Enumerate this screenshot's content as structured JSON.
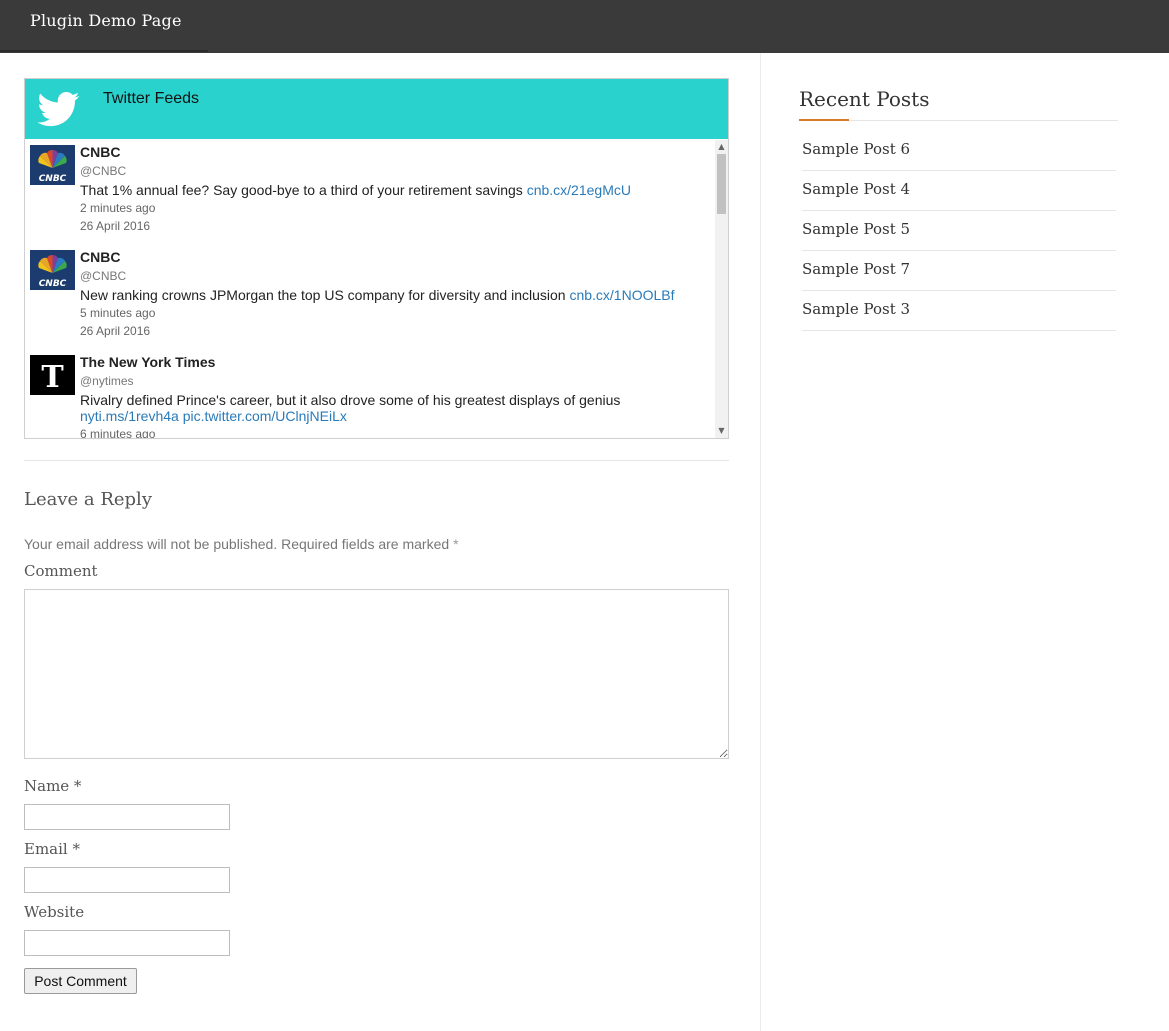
{
  "header": {
    "site_title": "Plugin Demo Page"
  },
  "twitter_widget": {
    "title": "Twitter Feeds",
    "bird_icon": "twitter-bird-icon",
    "tweets": [
      {
        "name": "CNBC",
        "handle": "@CNBC",
        "avatar": "cnbc-peacock-logo",
        "text": "That 1% annual fee? Say good-bye to a third of your retirement savings ",
        "link": "cnb.cx/21egMcU",
        "time_ago": "2 minutes ago",
        "date": "26 April 2016"
      },
      {
        "name": "CNBC",
        "handle": "@CNBC",
        "avatar": "cnbc-peacock-logo",
        "text": "New ranking crowns JPMorgan the top US company for diversity and inclusion ",
        "link": "cnb.cx/1NOOLBf",
        "time_ago": "5 minutes ago",
        "date": "26 April 2016"
      },
      {
        "name": "The New York Times",
        "handle": "@nytimes",
        "avatar": "nyt-logo",
        "text": "Rivalry defined Prince's career, but it also drove some of his greatest displays of genius",
        "link": "nyti.ms/1revh4a",
        "link2": "pic.twitter.com/UClnjNEiLx",
        "time_ago": "6 minutes ago"
      }
    ]
  },
  "reply_form": {
    "title": "Leave a Reply",
    "notes": "Your email address will not be published. Required fields are marked",
    "required_mark": "*",
    "comment_label": "Comment",
    "name_label": "Name *",
    "email_label": "Email *",
    "website_label": "Website",
    "submit_label": "Post Comment"
  },
  "sidebar": {
    "title": "Recent Posts",
    "accent_color": "#d67a27",
    "posts": [
      "Sample Post 6",
      "Sample Post 4",
      "Sample Post 5",
      "Sample Post 7",
      "Sample Post 3"
    ]
  },
  "colors": {
    "header_bg": "#3a3a3a",
    "twitter_header_bg": "#2ad2cd",
    "link": "#2a7ab8"
  }
}
